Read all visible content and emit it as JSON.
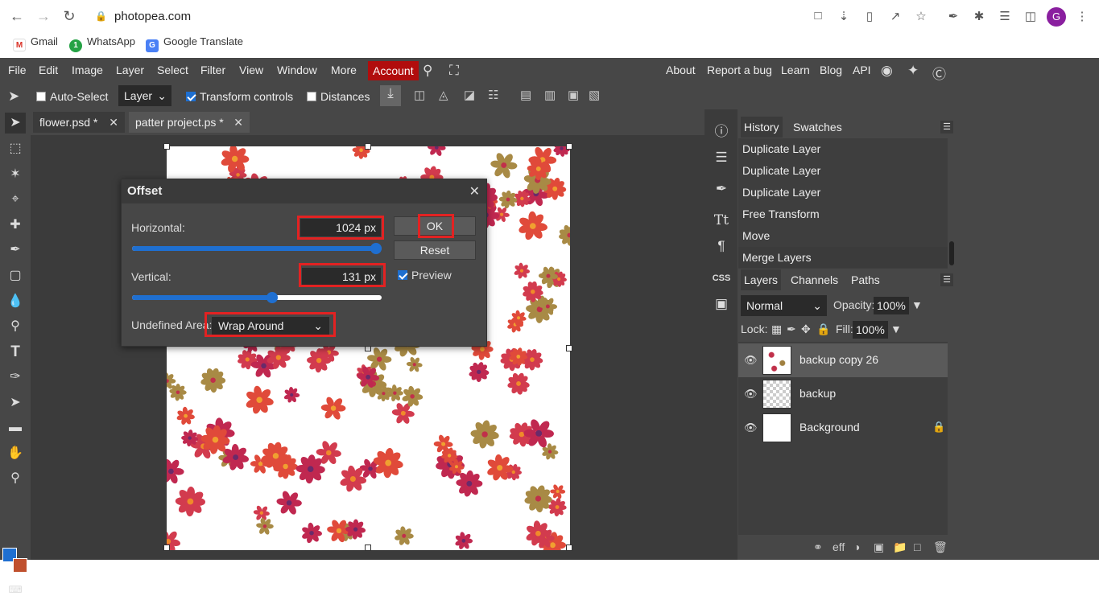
{
  "browser": {
    "url": "photopea.com",
    "avatar_letter": "G",
    "bookmarks": [
      {
        "label": "Gmail",
        "icon": "gmail-icon"
      },
      {
        "label": "WhatsApp",
        "icon": "whatsapp-icon"
      },
      {
        "label": "Google Translate",
        "icon": "google-translate-icon"
      }
    ]
  },
  "menubar": {
    "items": [
      "File",
      "Edit",
      "Image",
      "Layer",
      "Select",
      "Filter",
      "View",
      "Window",
      "More"
    ],
    "account": "Account",
    "right_items": [
      "About",
      "Report a bug",
      "Learn",
      "Blog",
      "API"
    ]
  },
  "options": {
    "auto_select": "Auto-Select",
    "layer_select": "Layer",
    "transform_controls": "Transform controls",
    "distances": "Distances"
  },
  "tabs": [
    {
      "label": "flower.psd *"
    },
    {
      "label": "patter project.ps *"
    }
  ],
  "dialog": {
    "title": "Offset",
    "horizontal_label": "Horizontal:",
    "horizontal_value": "1024  px",
    "horizontal_slider": 1.0,
    "vertical_label": "Vertical:",
    "vertical_value": "131  px",
    "vertical_slider": 0.56,
    "ok": "OK",
    "reset": "Reset",
    "preview": "Preview",
    "undefined_label": "Undefined Area:",
    "undefined_value": "Wrap Around"
  },
  "panels": {
    "history_tab": "History",
    "swatches_tab": "Swatches",
    "history": [
      "Duplicate Layer",
      "Duplicate Layer",
      "Duplicate Layer",
      "Free Transform",
      "Move",
      "Merge Layers"
    ],
    "layers_tab": "Layers",
    "channels_tab": "Channels",
    "paths_tab": "Paths",
    "blend_mode": "Normal",
    "opacity_label": "Opacity:",
    "opacity_value": "100%",
    "lock_label": "Lock:",
    "fill_label": "Fill:",
    "fill_value": "100%",
    "layers": [
      {
        "name": "backup copy 26",
        "selected": true
      },
      {
        "name": "backup",
        "selected": false
      },
      {
        "name": "Background",
        "selected": false,
        "locked": true
      }
    ]
  },
  "colors": {
    "accent": "#1f6fd0",
    "account_red": "#b10d0d",
    "highlight": "#e32222",
    "fg_color": "#1f6fd0",
    "bg_color": "#c0502e"
  }
}
